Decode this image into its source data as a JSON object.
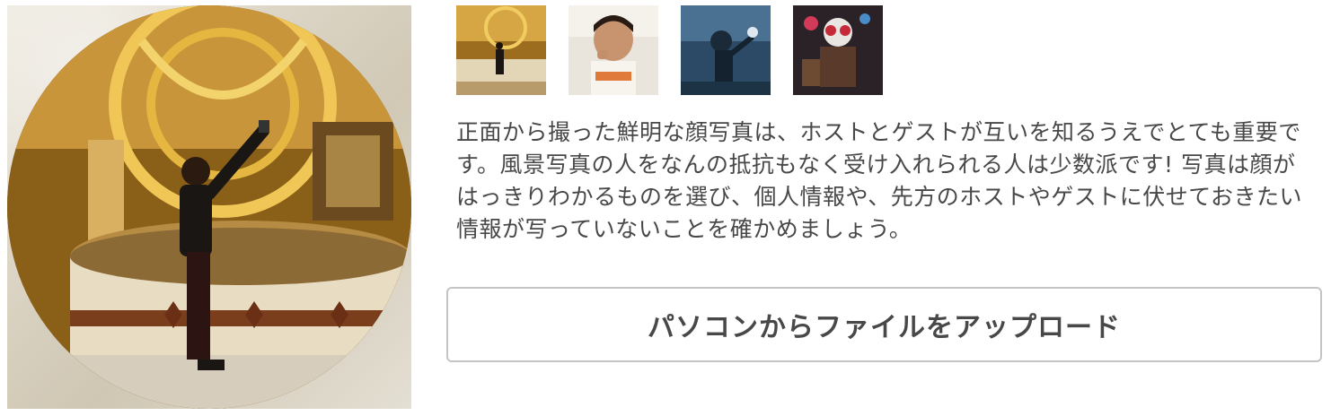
{
  "profile_photo": {
    "icon": "profile-photo-image",
    "alt": "profile photo"
  },
  "thumbnails": [
    {
      "icon": "thumbnail-palace-photo"
    },
    {
      "icon": "thumbnail-eating-photo"
    },
    {
      "icon": "thumbnail-diving-photo"
    },
    {
      "icon": "thumbnail-costume-photo"
    }
  ],
  "description": "正面から撮った鮮明な顔写真は、ホストとゲストが互いを知るうえでとても重要です。風景写真の人をなんの抵抗もなく受け入れられる人は少数派です! 写真は顔がはっきりわかるものを選び、個人情報や、先方のホストやゲストに伏せておきたい情報が写っていないことを確かめましょう。",
  "upload_button_label": "パソコンからファイルをアップロード",
  "colors": {
    "text": "#484848",
    "border": "#c4c4c4",
    "background": "#ffffff"
  }
}
